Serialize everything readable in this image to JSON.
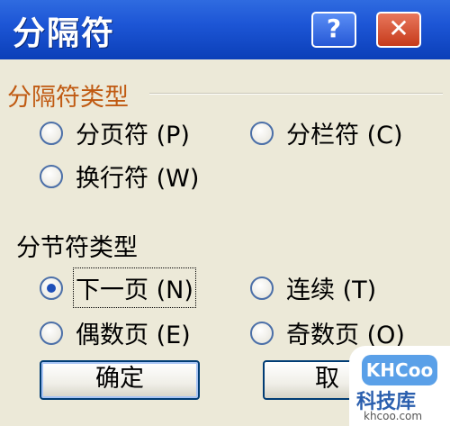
{
  "window": {
    "title": "分隔符",
    "help_label": "?",
    "close_label": "✕"
  },
  "break_types": {
    "title": "分隔符类型",
    "options": [
      {
        "label": "分页符 (P)",
        "checked": false
      },
      {
        "label": "分栏符 (C)",
        "checked": false
      },
      {
        "label": "换行符 (W)",
        "checked": false
      }
    ]
  },
  "section_break_types": {
    "title": "分节符类型",
    "options": [
      {
        "label": "下一页 (N)",
        "checked": true
      },
      {
        "label": "连续 (T)",
        "checked": false
      },
      {
        "label": "偶数页 (E)",
        "checked": false
      },
      {
        "label": "奇数页 (O)",
        "checked": false
      }
    ]
  },
  "buttons": {
    "ok": "确定",
    "cancel": "取"
  },
  "watermark": {
    "brand": "KHCoo",
    "cn": "科技库",
    "url": "khcoo.com"
  },
  "colors": {
    "titlebar": "#1d56d6",
    "group_title": "#c05a12",
    "dialog_bg": "#ece9d8"
  }
}
